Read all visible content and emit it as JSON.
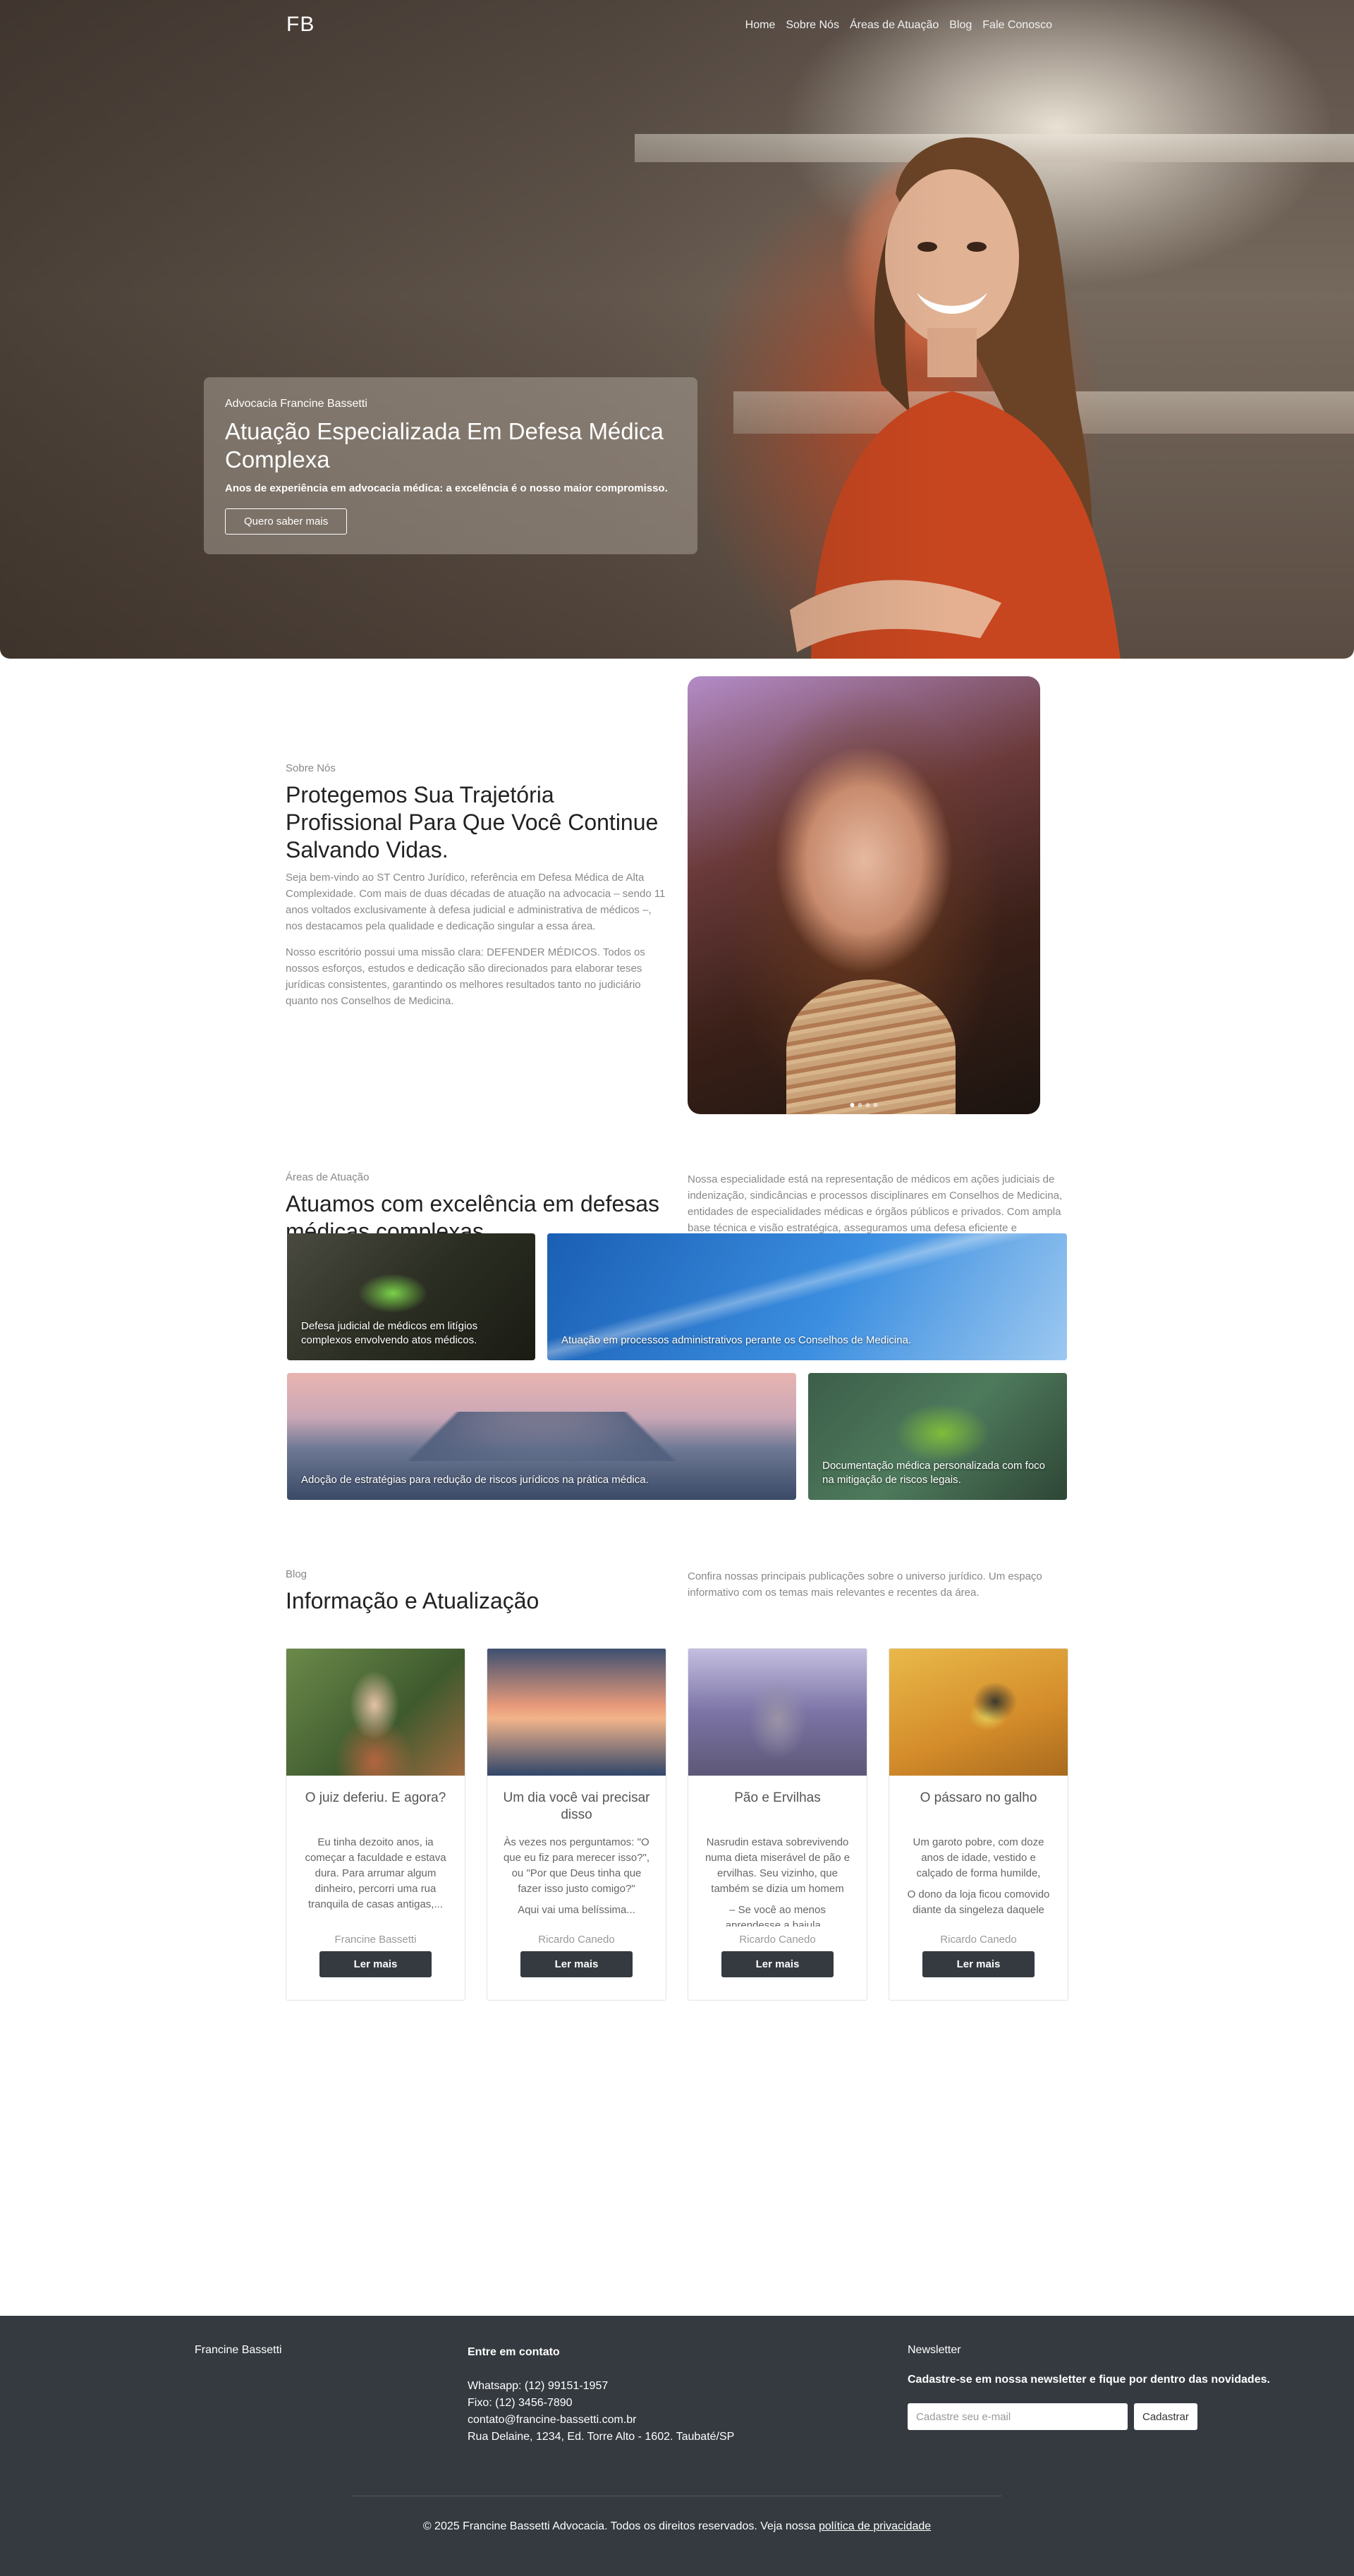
{
  "nav": {
    "logo": "FB",
    "items": [
      "Home",
      "Sobre Nós",
      "Áreas de Atuação",
      "Blog",
      "Fale Conosco"
    ]
  },
  "hero": {
    "kicker": "Advocacia Francine Bassetti",
    "title": "Atuação Especializada Em Defesa Médica Complexa",
    "subtitle": "Anos de experiência em advocacia médica: a excelência é o nosso maior compromisso.",
    "cta": "Quero saber mais"
  },
  "about": {
    "kicker": "Sobre Nós",
    "title": "Protegemos Sua Trajetória Profissional Para Que Você Continue Salvando Vidas.",
    "p1": "Seja bem-vindo ao ST Centro Jurídico, referência em Defesa Médica de Alta Complexidade. Com mais de duas décadas de atuação na advocacia – sendo 11 anos voltados exclusivamente à defesa judicial e administrativa de médicos –, nos destacamos pela qualidade e dedicação singular a essa área.",
    "p2": "Nosso escritório possui uma missão clara: DEFENDER MÉDICOS. Todos os nossos esforços, estudos e dedicação são direcionados para elaborar teses jurídicas consistentes, garantindo os melhores resultados tanto no judiciário quanto nos Conselhos de Medicina."
  },
  "areas": {
    "kicker": "Áreas de Atuação",
    "title": "Atuamos com excelência em defesas médicas complexas",
    "description": "Nossa especialidade está na representação de médicos em ações judiciais de indenização, sindicâncias e processos disciplinares em Conselhos de Medicina, entidades de especialidades médicas e órgãos públicos e privados. Com ampla base técnica e visão estratégica, asseguramos uma defesa eficiente e consistente.",
    "tiles": [
      "Defesa judicial de médicos em litígios complexos envolvendo atos médicos.",
      "Atuação em processos administrativos perante os Conselhos de Medicina.",
      "Adoção de estratégias para redução de riscos jurídicos na prática médica.",
      "Documentação médica personalizada com foco na mitigação de riscos legais."
    ]
  },
  "blog": {
    "kicker": "Blog",
    "title": "Informação e Atualização",
    "description": "Confira nossas principais publicações sobre o universo jurídico. Um espaço informativo com os temas mais relevantes e recentes da área.",
    "read_more": "Ler mais",
    "posts": [
      {
        "title": "O juiz deferiu. E agora?",
        "excerpt1": "Eu tinha dezoito anos, ia começar a faculdade e estava dura. Para arrumar algum dinheiro, percorri uma rua tranquila de casas antigas,...",
        "excerpt2": "",
        "author": "Francine Bassetti"
      },
      {
        "title": "Um dia você vai precisar disso",
        "excerpt1": "Às vezes nos perguntamos: \"O que eu fiz para merecer isso?\", ou \"Por que Deus tinha que fazer isso justo comigo?\"",
        "excerpt2": "Aqui vai uma belíssima...",
        "author": "Ricardo Canedo"
      },
      {
        "title": "Pão e Ervilhas",
        "excerpt1": "Nasrudin estava sobrevivendo numa dieta miserável de pão e ervilhas. Seu vizinho, que também se dizia um homem",
        "excerpt2": "– Se você ao menos aprendesse a bajula...",
        "author": "Ricardo Canedo"
      },
      {
        "title": "O pássaro no galho",
        "excerpt1": "Um garoto pobre, com doze anos de idade, vestido e calçado de forma humilde,",
        "excerpt2": "O dono da loja ficou comovido diante da singeleza daquele",
        "author": "Ricardo Canedo"
      }
    ]
  },
  "footer": {
    "brand": "Francine Bassetti",
    "contact_title": "Entre em contato",
    "whatsapp": "Whatsapp: (12) 99151-1957",
    "phone": "Fixo: (12) 3456-7890",
    "email": "contato@francine-bassetti.com.br",
    "address": "Rua Delaine, 1234, Ed. Torre Alto - 1602. Taubaté/SP",
    "newsletter_title": "Newsletter",
    "newsletter_desc": "Cadastre-se em nossa newsletter e fique por dentro das novidades.",
    "email_placeholder": "Cadastre seu e-mail",
    "submit": "Cadastrar",
    "copyright": "© 2025 Francine Bassetti Advocacia. Todos os direitos reservados. Veja nossa ",
    "privacy": "política de privacidade"
  }
}
